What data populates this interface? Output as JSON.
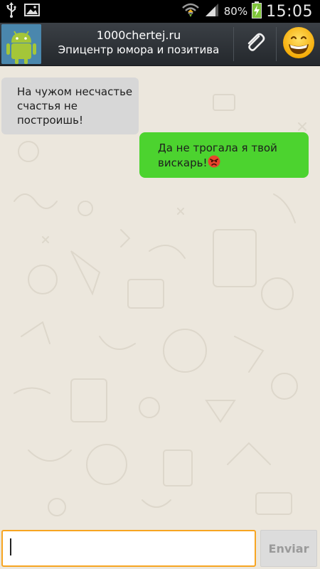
{
  "status_bar": {
    "battery_percent": "80%",
    "time": "15:05",
    "icons": [
      "usb-icon",
      "image-icon",
      "wifi-icon",
      "signal-icon",
      "battery-charging-icon"
    ]
  },
  "header": {
    "title": "1000chertej.ru",
    "subtitle": "Эпицентр юмора и позитива",
    "avatar_icon": "android-icon",
    "attach_icon": "paperclip-icon",
    "emoji_icon": "smiley-icon"
  },
  "chat": {
    "messages": [
      {
        "direction": "incoming",
        "lines": [
          "На чужом несчастье",
          "счастья не построишь!"
        ]
      },
      {
        "direction": "outgoing",
        "lines": [
          "Да не трогала я твой",
          "вискарь!"
        ],
        "emoji": "angry-face-icon"
      }
    ],
    "colors": {
      "incoming_bubble": "#d7d7d7",
      "outgoing_bubble": "#4cd32f",
      "background": "#ece7dd"
    }
  },
  "composer": {
    "input_value": "",
    "send_label": "Enviar",
    "focus_color": "#f7a521"
  }
}
